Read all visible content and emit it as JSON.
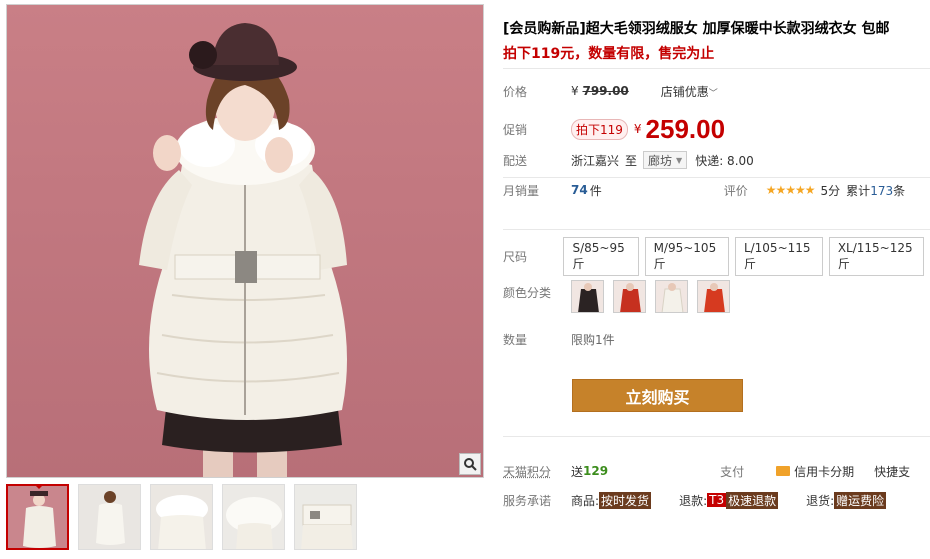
{
  "product": {
    "title": "[会员购新品]超大毛领羽绒服女 加厚保暖中长款羽绒衣女 包邮",
    "subtitle": "拍下119元，数量有限，售完为止"
  },
  "price": {
    "label": "价格",
    "currency": "¥",
    "original": "799.00",
    "shop_promo": "店铺优惠"
  },
  "promo": {
    "label": "促销",
    "tag": "拍下119",
    "currency": "¥",
    "price": "259.00"
  },
  "shipping": {
    "label": "配送",
    "from": "浙江嘉兴",
    "to_word": "至",
    "to_city": "廊坊",
    "express": "快递: 8.00"
  },
  "sales": {
    "label": "月销量",
    "count": "74",
    "unit": "件",
    "rating_label": "评价",
    "stars": "★★★★★",
    "score": "5分",
    "reviews_prefix": "累计",
    "reviews_count": "173",
    "reviews_suffix": "条"
  },
  "size": {
    "label": "尺码",
    "options": [
      "S/85~95斤",
      "M/95~105斤",
      "L/105~115斤",
      "XL/115~125斤"
    ]
  },
  "color": {
    "label": "颜色分类"
  },
  "quantity": {
    "label": "数量",
    "limit": "限购1件"
  },
  "buy": {
    "label": "立刻购买"
  },
  "points": {
    "label": "天猫积分",
    "send": "送",
    "value": "129",
    "pay_label": "支付",
    "card": "信用卡分期",
    "quick": "快捷支"
  },
  "service": {
    "label": "服务承诺",
    "goods": "商品:",
    "goods_badge": "按时发货",
    "refund": "退款:",
    "refund_code": "T3",
    "refund_badge": "极速退款",
    "return": "退货:",
    "return_badge": "赠运费险"
  },
  "colors": {
    "accent": "#c40000",
    "buy_button": "#c6822a",
    "background_pink": "#c27880"
  }
}
